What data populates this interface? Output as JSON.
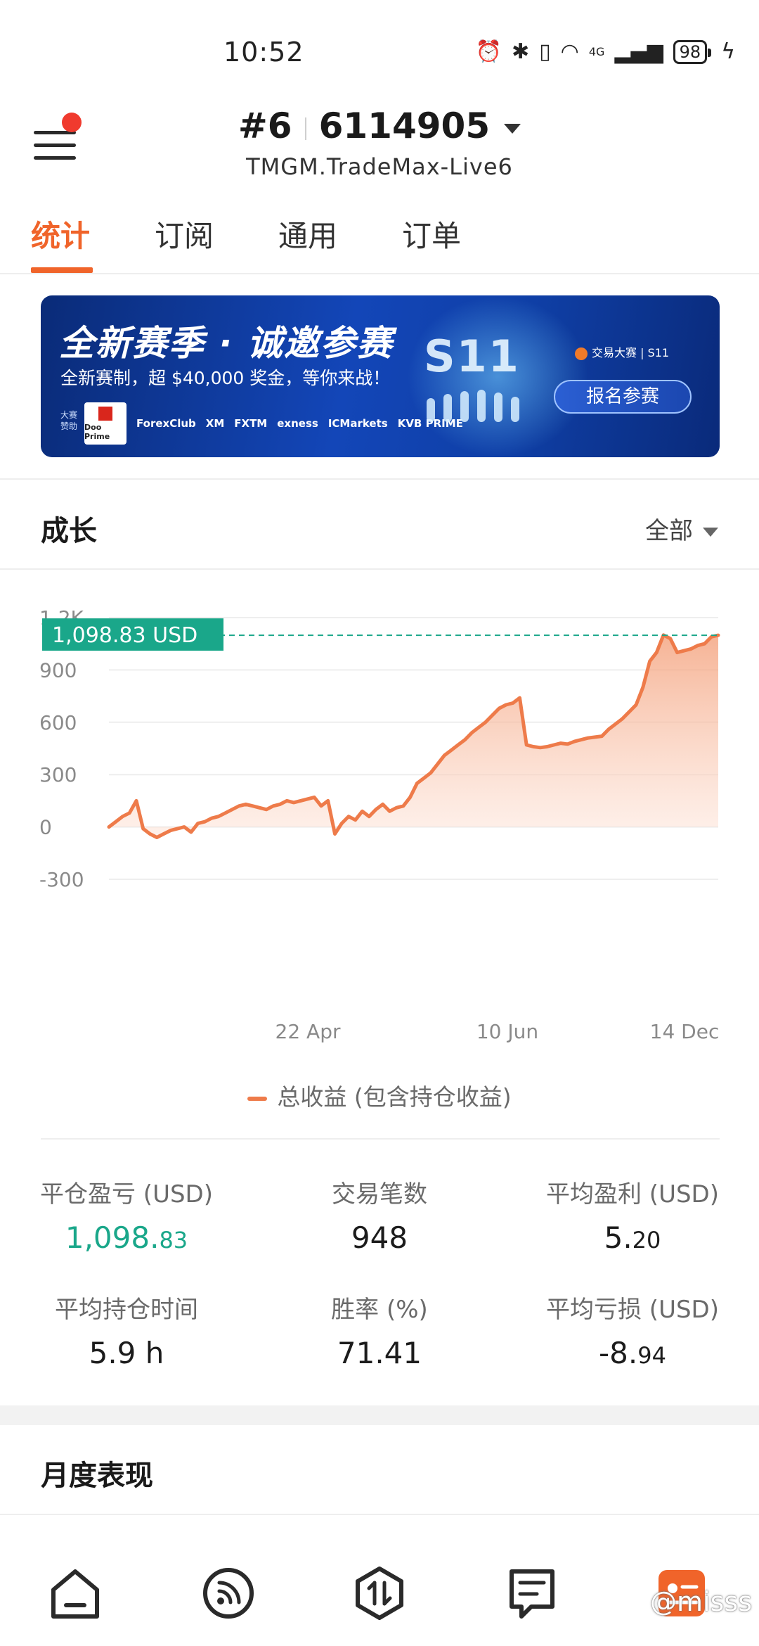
{
  "status_bar": {
    "time": "10:52",
    "network": "4G",
    "battery": "98"
  },
  "header": {
    "account_number": "#6",
    "account_id": "6114905",
    "server": "TMGM.TradeMax-Live6"
  },
  "tabs": [
    {
      "label": "统计",
      "active": true
    },
    {
      "label": "订阅",
      "active": false
    },
    {
      "label": "通用",
      "active": false
    },
    {
      "label": "订单",
      "active": false
    }
  ],
  "banner": {
    "title": "全新赛季 · 诚邀参赛",
    "subtitle": "全新赛制，超 $40,000 奖金，等你来战！",
    "sponsor_label": "大赛赞助",
    "sponsors": [
      "Doo Prime",
      "ForexClub",
      "XM",
      "FXTM",
      "exness",
      "ICMarkets",
      "KVB PRIME"
    ],
    "season": "S11",
    "brand": "交易大赛 | S11",
    "button": "报名参赛"
  },
  "growth": {
    "title": "成长",
    "filter": "全部"
  },
  "chart_data": {
    "type": "area",
    "title": "",
    "current_label": "1,098.83 USD",
    "y_ticks": [
      "1.2K",
      "900",
      "600",
      "300",
      "0",
      "-300"
    ],
    "ylim": [
      -300,
      1200
    ],
    "x_ticks": [
      "22 Apr",
      "10 Jun",
      "14 Dec"
    ],
    "series": [
      {
        "name": "总收益 (包含持仓收益)",
        "color": "#ee7b4a",
        "values": [
          0,
          30,
          60,
          80,
          150,
          -10,
          -40,
          -60,
          -40,
          -20,
          -10,
          0,
          -30,
          20,
          30,
          50,
          60,
          80,
          100,
          120,
          130,
          120,
          110,
          100,
          120,
          130,
          150,
          140,
          150,
          160,
          170,
          120,
          150,
          -40,
          20,
          60,
          40,
          90,
          60,
          100,
          130,
          90,
          110,
          120,
          170,
          250,
          280,
          310,
          360,
          410,
          440,
          470,
          500,
          540,
          570,
          600,
          640,
          680,
          700,
          710,
          740,
          470,
          460,
          455,
          460,
          470,
          480,
          475,
          490,
          500,
          510,
          515,
          520,
          560,
          590,
          620,
          660,
          700,
          800,
          950,
          1000,
          1100,
          1080,
          1000,
          1010,
          1020,
          1040,
          1050,
          1090,
          1098.83
        ]
      }
    ]
  },
  "legend": {
    "label": "总收益 (包含持仓收益)"
  },
  "stats": [
    {
      "label": "平仓盈亏 (USD)",
      "value_int": "1,098.",
      "value_dec": "83",
      "color": "green"
    },
    {
      "label": "交易笔数",
      "value_int": "948",
      "value_dec": "",
      "color": "default"
    },
    {
      "label": "平均盈利 (USD)",
      "value_int": "5.",
      "value_dec": "20",
      "color": "default"
    },
    {
      "label": "平均持仓时间",
      "value_int": "5.9 h",
      "value_dec": "",
      "color": "default"
    },
    {
      "label": "胜率 (%)",
      "value_int": "71.41",
      "value_dec": "",
      "color": "default"
    },
    {
      "label": "平均亏损 (USD)",
      "value_int": "-8.",
      "value_dec": "94",
      "color": "default"
    }
  ],
  "monthly": {
    "title": "月度表现"
  },
  "bottom_nav": [
    {
      "icon": "home-icon"
    },
    {
      "icon": "signal-icon"
    },
    {
      "icon": "trade-icon"
    },
    {
      "icon": "orders-icon"
    },
    {
      "icon": "profile-icon"
    }
  ],
  "watermark": "@misss"
}
